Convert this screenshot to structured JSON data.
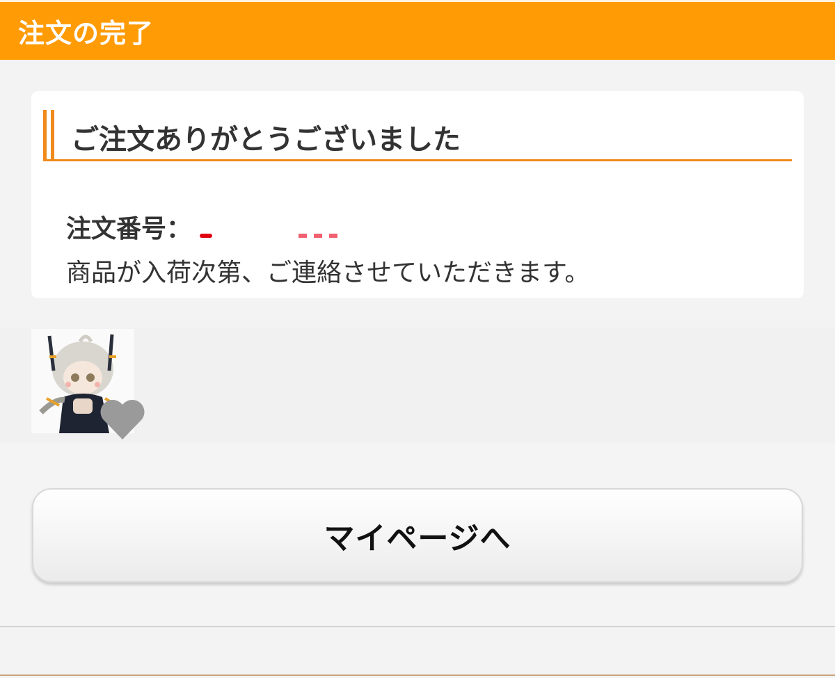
{
  "header": {
    "title": "注文の完了",
    "color": "#ff9b04"
  },
  "card": {
    "heading": "ご注文ありがとうございました",
    "order_label": "注文番号：",
    "notice": "商品が入荷次第、ご連絡させていただきます。"
  },
  "item": {
    "thumbnail_icon": "character-figure-image",
    "favorite_icon": "heart-icon"
  },
  "actions": {
    "mypage_label": "マイページへ"
  },
  "colors": {
    "accent": "#f08a1c",
    "background": "#f3f3f3",
    "card": "#ffffff",
    "heart": "#9a9a9a"
  }
}
